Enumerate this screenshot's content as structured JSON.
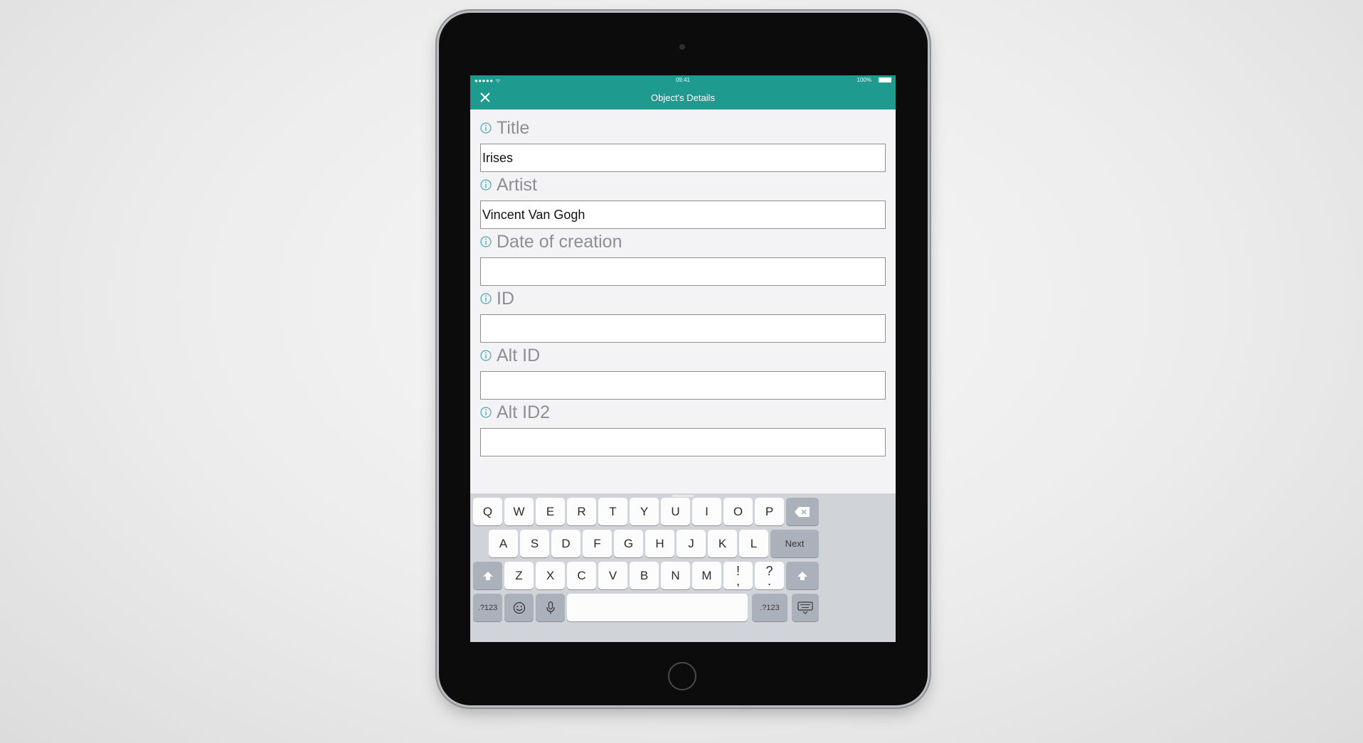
{
  "status_bar": {
    "signal": "●●●●● ᯤ",
    "time": "09:41",
    "battery": "100%"
  },
  "nav": {
    "title": "Object's Details"
  },
  "fields": [
    {
      "label": "Title",
      "value": "Irises"
    },
    {
      "label": "Artist",
      "value": "Vincent Van Gogh"
    },
    {
      "label": "Date of creation",
      "value": ""
    },
    {
      "label": "ID",
      "value": ""
    },
    {
      "label": "Alt ID",
      "value": ""
    },
    {
      "label": "Alt ID2",
      "value": ""
    }
  ],
  "keyboard": {
    "row1": [
      "Q",
      "W",
      "E",
      "R",
      "T",
      "Y",
      "U",
      "I",
      "O",
      "P"
    ],
    "row2": [
      "A",
      "S",
      "D",
      "F",
      "G",
      "H",
      "J",
      "K",
      "L"
    ],
    "next_label": "Next",
    "row3": [
      "Z",
      "X",
      "C",
      "V",
      "B",
      "N",
      "M"
    ],
    "punct1": {
      "top": "!",
      "bottom": ","
    },
    "punct2": {
      "top": "?",
      "bottom": "."
    },
    "numbers_left": ".?123",
    "numbers_right": ".?123"
  },
  "colors": {
    "accent": "#1e9a8f",
    "keyboard_bg": "#d0d4d9",
    "label": "#8e8e96"
  }
}
